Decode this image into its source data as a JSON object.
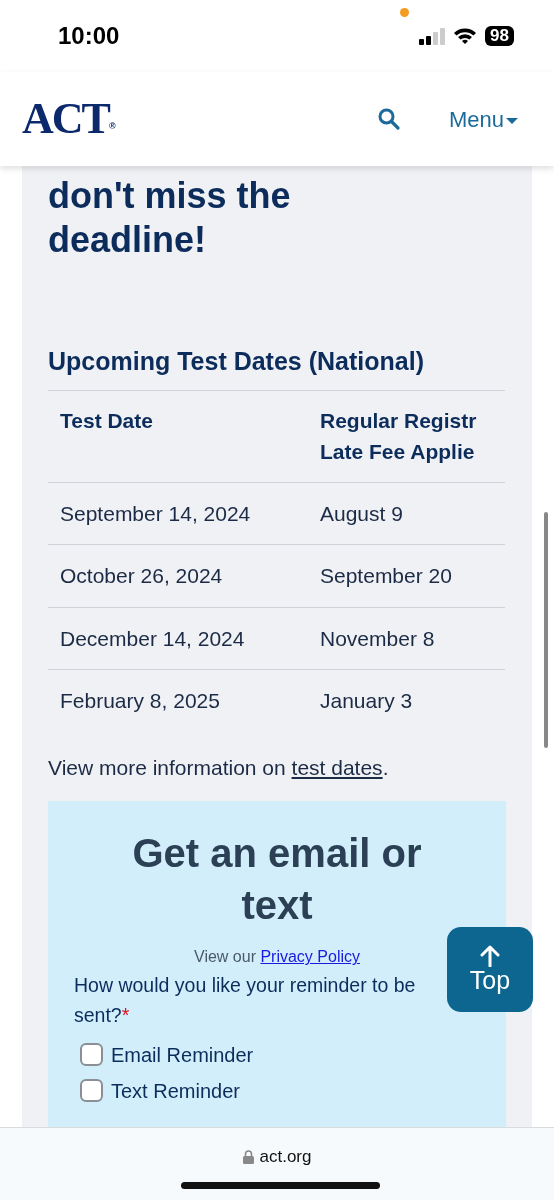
{
  "status_bar": {
    "time": "10:00",
    "battery": "98",
    "recording_dot": true
  },
  "header": {
    "logo": "ACT",
    "logo_mark": "®",
    "menu": "Menu"
  },
  "heading": "don't miss the deadline!",
  "table": {
    "title": "Upcoming Test Dates (National)",
    "columns": [
      {
        "lines": [
          "Test Date"
        ]
      },
      {
        "lines": [
          "Regular Registr",
          "Late Fee Applie"
        ]
      }
    ],
    "rows": [
      [
        "September 14, 2024",
        "August 9"
      ],
      [
        "October 26, 2024",
        "September 20"
      ],
      [
        "December 14, 2024",
        "November 8"
      ],
      [
        "February 8, 2025",
        "January 3"
      ]
    ]
  },
  "more_info": {
    "text": "View more information on ",
    "link": "test dates",
    "end": "."
  },
  "signup": {
    "title": "Get an email or text",
    "privacy_text": "View our ",
    "privacy_link": "Privacy Policy",
    "question": "How would you like your reminder to be sent?",
    "required": "*",
    "options": [
      {
        "label": "Email Reminder",
        "checked": false
      },
      {
        "label": "Text Reminder",
        "checked": false
      }
    ]
  },
  "top_button": "Top",
  "browser": {
    "url": "act.org"
  }
}
